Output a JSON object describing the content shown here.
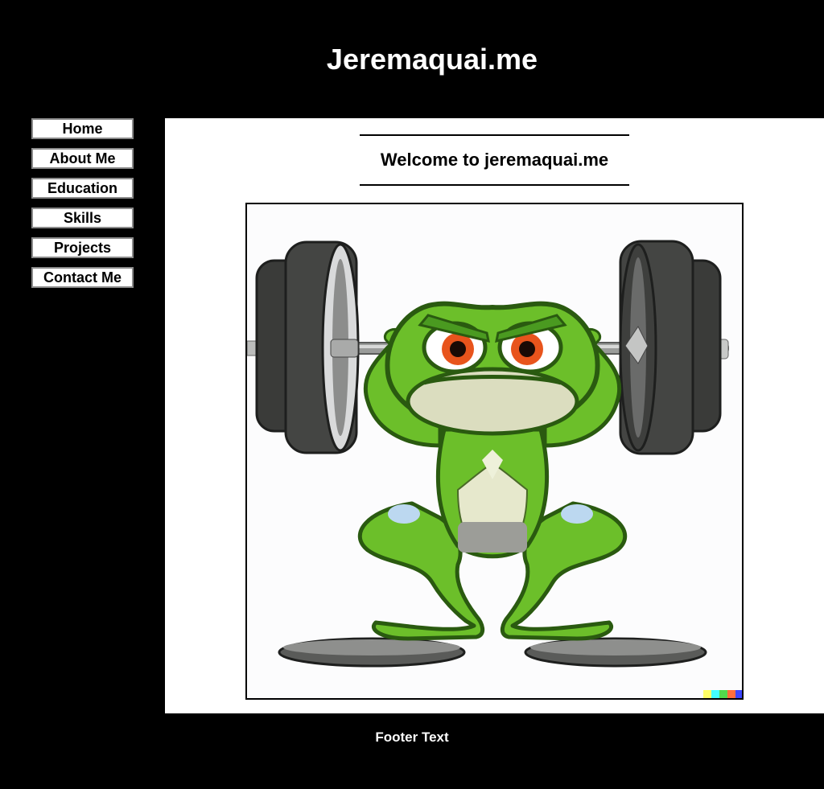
{
  "header": {
    "title": "Jeremaquai.me"
  },
  "sidebar": {
    "items": [
      {
        "label": "Home"
      },
      {
        "label": "About Me"
      },
      {
        "label": "Education"
      },
      {
        "label": "Skills"
      },
      {
        "label": "Projects"
      },
      {
        "label": "Contact Me"
      }
    ]
  },
  "main": {
    "heading": "Welcome to jeremaquai.me",
    "image": {
      "subject": "muscular green frog lifting barbell illustration"
    }
  },
  "footer": {
    "text": "Footer Text"
  },
  "colors": {
    "page_background": "#000000",
    "content_background": "#ffffff",
    "text_on_dark": "#ffffff",
    "text_on_light": "#000000",
    "button_border": "#8a8a8a",
    "frog_green": "#6cbf2a",
    "frog_dark": "#2f6e12",
    "frog_belly": "#e6e8cc",
    "eye_orange": "#e8541c",
    "plate_dark": "#3a3b39"
  }
}
